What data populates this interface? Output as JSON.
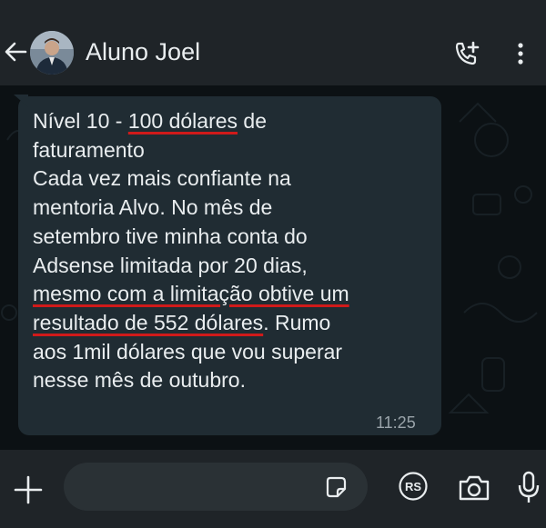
{
  "header": {
    "title": "Aluno Joel",
    "back_icon": "arrow-left-icon",
    "call_icon": "add-call-icon",
    "menu_icon": "vertical-ellipsis-icon"
  },
  "message": {
    "lines": [
      [
        "Nível 10 - ",
        {
          "u": "100 dólares"
        },
        " de"
      ],
      [
        "faturamento"
      ],
      [
        "Cada vez mais confiante na"
      ],
      [
        "mentoria Alvo. No mês de"
      ],
      [
        "setembro tive minha conta do"
      ],
      [
        "Adsense limitada por 20 dias,"
      ],
      [
        {
          "u": "mesmo com a limitação obtive um"
        }
      ],
      [
        {
          "u": "resultado de 552 dólares"
        },
        ". Rumo"
      ],
      [
        "aos 1mil dólares que vou superar"
      ],
      [
        "nesse mês de outubro."
      ]
    ],
    "time": "11:25"
  },
  "composer": {
    "placeholder": "",
    "icons": [
      "plus-icon",
      "sticker-icon",
      "rs-icon",
      "camera-icon",
      "microphone-icon"
    ]
  },
  "colors": {
    "header_bg": "#1f2428",
    "bubble_bg": "#202c33",
    "text": "#e9edef",
    "underline": "#d01a1a",
    "time": "#9aa4aa"
  }
}
